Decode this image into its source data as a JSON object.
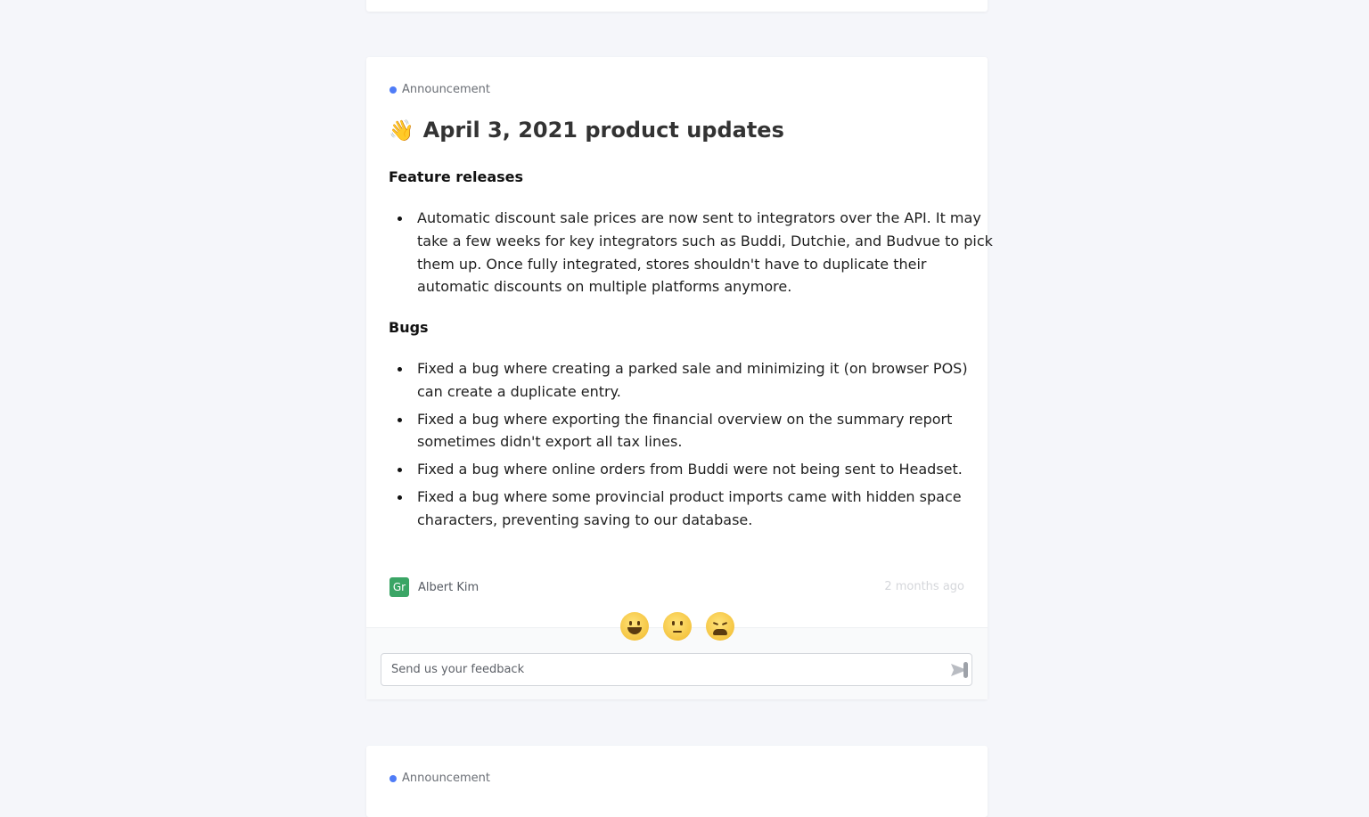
{
  "post": {
    "category": "Announcement",
    "title": "April 3, 2021 product updates",
    "title_emoji": "👋",
    "sections": [
      {
        "heading": "Feature releases",
        "items": [
          "Automatic discount sale prices are now sent to integrators over the API. It may take a few weeks for key integrators such as Buddi, Dutchie, and Budvue to pick them up. Once fully integrated, stores shouldn't have to duplicate their automatic discounts on multiple platforms anymore."
        ]
      },
      {
        "heading": "Bugs",
        "items": [
          "Fixed a bug where creating a parked sale and minimizing it (on browser POS) can create a duplicate entry.",
          "Fixed a bug where exporting the financial overview on the summary report sometimes didn't export all tax lines.",
          "Fixed a bug where online orders from Buddi were not being sent to Headset.",
          "Fixed a bug where some provincial product imports came with hidden space characters, preventing saving to our database."
        ]
      }
    ],
    "author": {
      "initials": "Gr",
      "name": "Albert Kim",
      "avatar_color": "#3aa565"
    },
    "timestamp": "2 months ago"
  },
  "feedback": {
    "reactions": [
      "grinning-face-icon",
      "neutral-face-icon",
      "weary-face-icon"
    ],
    "placeholder": "Send us your feedback"
  },
  "next_post": {
    "category": "Announcement"
  },
  "colors": {
    "accent_dot": "#4f7cf7",
    "background": "#f5f6fa"
  }
}
